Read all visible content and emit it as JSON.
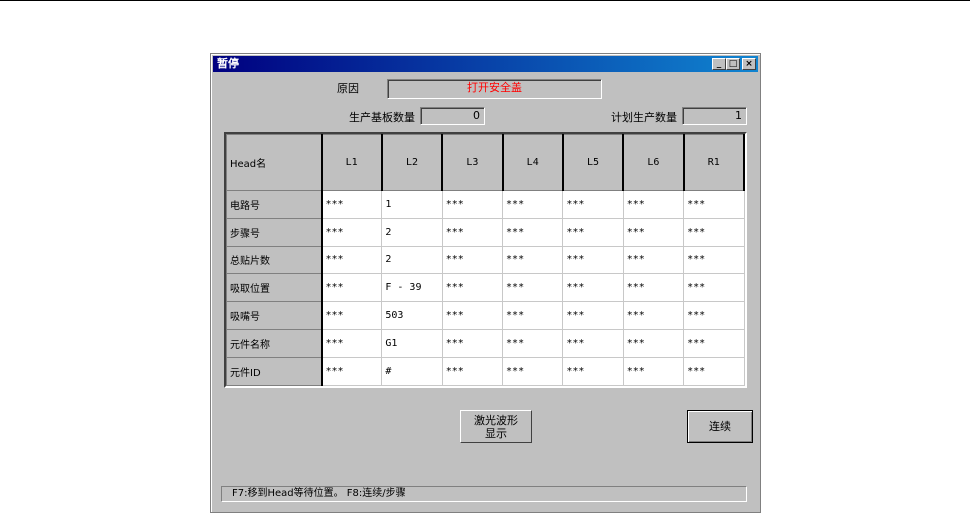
{
  "window": {
    "title": "暂停",
    "min": "_",
    "max": "□",
    "close": "×"
  },
  "reason": {
    "label": "原因",
    "value": "打开安全盖",
    "color": "#ff0000"
  },
  "produced": {
    "label": "生产基板数量",
    "value": "0"
  },
  "planned": {
    "label": "计划生产数量",
    "value": "1"
  },
  "table": {
    "corner": "Head名",
    "columns": [
      "L1",
      "L2",
      "L3",
      "L4",
      "L5",
      "L6",
      "R1"
    ],
    "rows": [
      {
        "label": "电路号",
        "cells": [
          "***",
          "1",
          "***",
          "***",
          "***",
          "***",
          "***"
        ]
      },
      {
        "label": "步骤号",
        "cells": [
          "***",
          "2",
          "***",
          "***",
          "***",
          "***",
          "***"
        ]
      },
      {
        "label": "总贴片数",
        "cells": [
          "***",
          "2",
          "***",
          "***",
          "***",
          "***",
          "***"
        ]
      },
      {
        "label": "吸取位置",
        "cells": [
          "***",
          "F - 39",
          "***",
          "***",
          "***",
          "***",
          "***"
        ]
      },
      {
        "label": "吸嘴号",
        "cells": [
          "***",
          "503",
          "***",
          "***",
          "***",
          "***",
          "***"
        ]
      },
      {
        "label": "元件名称",
        "cells": [
          "***",
          "G1",
          "***",
          "***",
          "***",
          "***",
          "***"
        ]
      },
      {
        "label": "元件ID",
        "cells": [
          "***",
          "#",
          "***",
          "***",
          "***",
          "***",
          "***"
        ]
      }
    ]
  },
  "buttons": {
    "laser_line1": "激光波形",
    "laser_line2": "显示",
    "continue": "连续"
  },
  "status": "F7:移到Head等待位置。  F8:连续/步骤"
}
